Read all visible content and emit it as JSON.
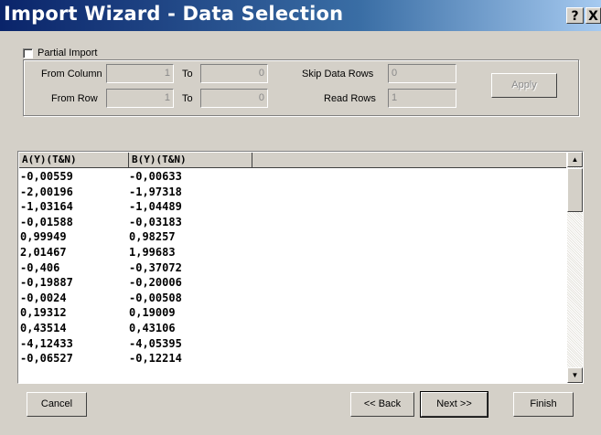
{
  "window": {
    "title": "Import Wizard - Data Selection",
    "help_label": "?",
    "close_label": "X"
  },
  "partial_import": {
    "label": "Partial Import",
    "checked": false,
    "from_column_label": "From Column",
    "from_column_value": "1",
    "to_column_label": "To",
    "to_column_value": "0",
    "from_row_label": "From Row",
    "from_row_value": "1",
    "to_row_label": "To",
    "to_row_value": "0",
    "skip_rows_label": "Skip Data Rows",
    "skip_rows_value": "0",
    "read_rows_label": "Read Rows",
    "read_rows_value": "1",
    "apply_label": "Apply"
  },
  "grid": {
    "columns": [
      "A(Y)(T&N)",
      "B(Y)(T&N)"
    ],
    "rows": [
      [
        "-0,00559",
        "-0,00633"
      ],
      [
        "-2,00196",
        "-1,97318"
      ],
      [
        "-1,03164",
        "-1,04489"
      ],
      [
        "-0,01588",
        "-0,03183"
      ],
      [
        "0,99949",
        "0,98257"
      ],
      [
        "2,01467",
        "1,99683"
      ],
      [
        "-0,406",
        "-0,37072"
      ],
      [
        "-0,19887",
        "-0,20006"
      ],
      [
        "-0,0024",
        "-0,00508"
      ],
      [
        "0,19312",
        "0,19009"
      ],
      [
        "0,43514",
        "0,43106"
      ],
      [
        "-4,12433",
        "-4,05395"
      ],
      [
        "-0,06527",
        "-0,12214"
      ]
    ]
  },
  "scrollbar": {
    "up_icon": "arrow-up-icon",
    "down_icon": "arrow-down-icon"
  },
  "buttons": {
    "cancel": "Cancel",
    "back": "<< Back",
    "next": "Next >>",
    "finish": "Finish"
  }
}
